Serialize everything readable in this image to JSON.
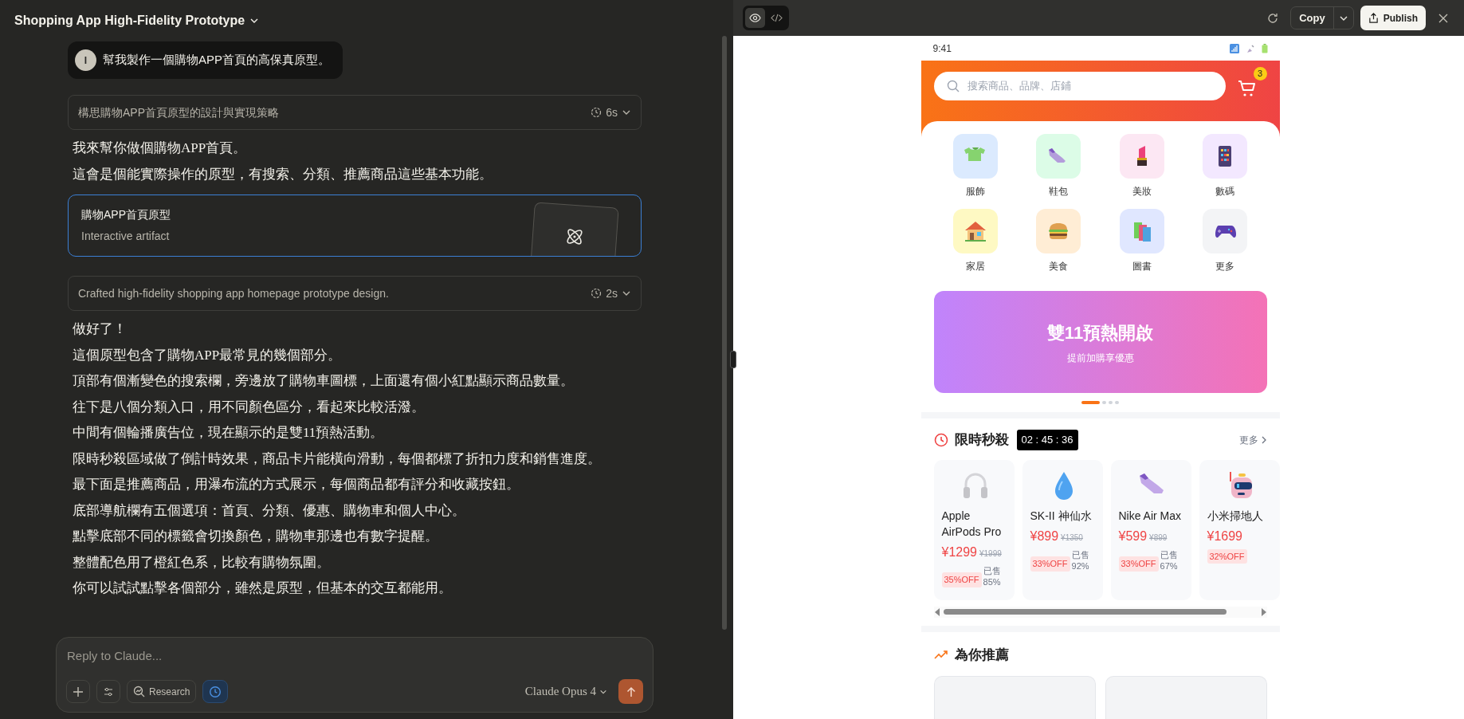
{
  "header": {
    "title": "Shopping App High-Fidelity Prototype"
  },
  "chat": [
    {
      "kind": "user",
      "avatar": "I",
      "text": "幫我製作一個購物APP首頁的高保真原型。"
    },
    {
      "kind": "thinking",
      "text": "構思購物APP首頁原型的設計與實現策略",
      "duration": "6s"
    },
    {
      "kind": "paragraph",
      "text": "我來幫你做個購物APP首頁。"
    },
    {
      "kind": "paragraph",
      "text": "這會是個能實際操作的原型，有搜索、分類、推薦商品這些基本功能。"
    },
    {
      "kind": "artifact",
      "title": "購物APP首頁原型",
      "subtitle": "Interactive artifact"
    },
    {
      "kind": "thinking",
      "text": "Crafted high-fidelity shopping app homepage prototype design.",
      "duration": "2s"
    },
    {
      "kind": "paragraph",
      "text": "做好了！"
    },
    {
      "kind": "paragraph",
      "text": "這個原型包含了購物APP最常見的幾個部分。"
    },
    {
      "kind": "paragraph",
      "text": "頂部有個漸變色的搜索欄，旁邊放了購物車圖標，上面還有個小紅點顯示商品數量。"
    },
    {
      "kind": "paragraph",
      "text": "往下是八個分類入口，用不同顏色區分，看起來比較活潑。"
    },
    {
      "kind": "paragraph",
      "text": "中間有個輪播廣告位，現在顯示的是雙11預熱活動。"
    },
    {
      "kind": "paragraph",
      "text": "限時秒殺區域做了倒計時效果，商品卡片能橫向滑動，每個都標了折扣力度和銷售進度。"
    },
    {
      "kind": "paragraph",
      "text": "最下面是推薦商品，用瀑布流的方式展示，每個商品都有評分和收藏按鈕。"
    },
    {
      "kind": "paragraph",
      "text": "底部導航欄有五個選項：首頁、分類、優惠、購物車和個人中心。"
    },
    {
      "kind": "paragraph",
      "text": "點擊底部不同的標籤會切換顏色，購物車那邊也有數字提醒。"
    },
    {
      "kind": "paragraph",
      "text": "整體配色用了橙紅色系，比較有購物氛圍。"
    },
    {
      "kind": "paragraph",
      "text": "你可以試試點擊各個部分，雖然是原型，但基本的交互都能用。"
    }
  ],
  "composer": {
    "placeholder": "Reply to Claude...",
    "research": "Research",
    "extended_thinking": true,
    "model": "Claude Opus 4"
  },
  "artifact_panel": {
    "views": [
      {
        "kind": "preview",
        "selected": true
      },
      {
        "kind": "code",
        "selected": false
      }
    ],
    "copy": "Copy",
    "publish": "Publish"
  },
  "phone": {
    "time": "9:41",
    "search": {
      "placeholder": "搜索商品、品牌、店鋪"
    },
    "cart_badge": "3",
    "categories": [
      {
        "kind": "shirt",
        "label": "服飾",
        "color": "#dbeafe"
      },
      {
        "kind": "shoe",
        "label": "鞋包",
        "color": "#dcfce7"
      },
      {
        "kind": "lipstick",
        "label": "美妝",
        "color": "#fce7f3"
      },
      {
        "kind": "device",
        "label": "數碼",
        "color": "#f3e8ff"
      },
      {
        "kind": "house",
        "label": "家居",
        "color": "#fef9c3"
      },
      {
        "kind": "burger",
        "label": "美食",
        "color": "#ffedd5"
      },
      {
        "kind": "books",
        "label": "圖書",
        "color": "#e0e7ff"
      },
      {
        "kind": "gamepad",
        "label": "更多",
        "color": "#f3f4f6"
      }
    ],
    "banner": {
      "title": "雙11預熱開啟",
      "subtitle": "提前加購享優惠"
    },
    "banner_dots": [
      {
        "selected": true
      },
      {
        "selected": false
      },
      {
        "selected": false
      },
      {
        "selected": false
      }
    ],
    "flash_sale": {
      "title": "限時秒殺",
      "timer": "02 : 45 : 36",
      "more": "更多",
      "products": [
        {
          "kind": "headphones",
          "name": "Apple AirPods Pro",
          "price": "¥1299",
          "original_price": "¥1999",
          "discount": "35%OFF",
          "sold": "已售85%"
        },
        {
          "kind": "droplet",
          "name": "SK-II 神仙水",
          "price": "¥899",
          "original_price": "¥1350",
          "discount": "33%OFF",
          "sold": "已售92%"
        },
        {
          "kind": "sneaker",
          "name": "Nike Air Max",
          "price": "¥599",
          "original_price": "¥899",
          "discount": "33%OFF",
          "sold": "已售67%"
        },
        {
          "kind": "robot",
          "name": "小米掃地人",
          "price": "¥1699",
          "discount": "32%OFF"
        }
      ]
    },
    "recommend": {
      "title": "為你推薦"
    }
  }
}
